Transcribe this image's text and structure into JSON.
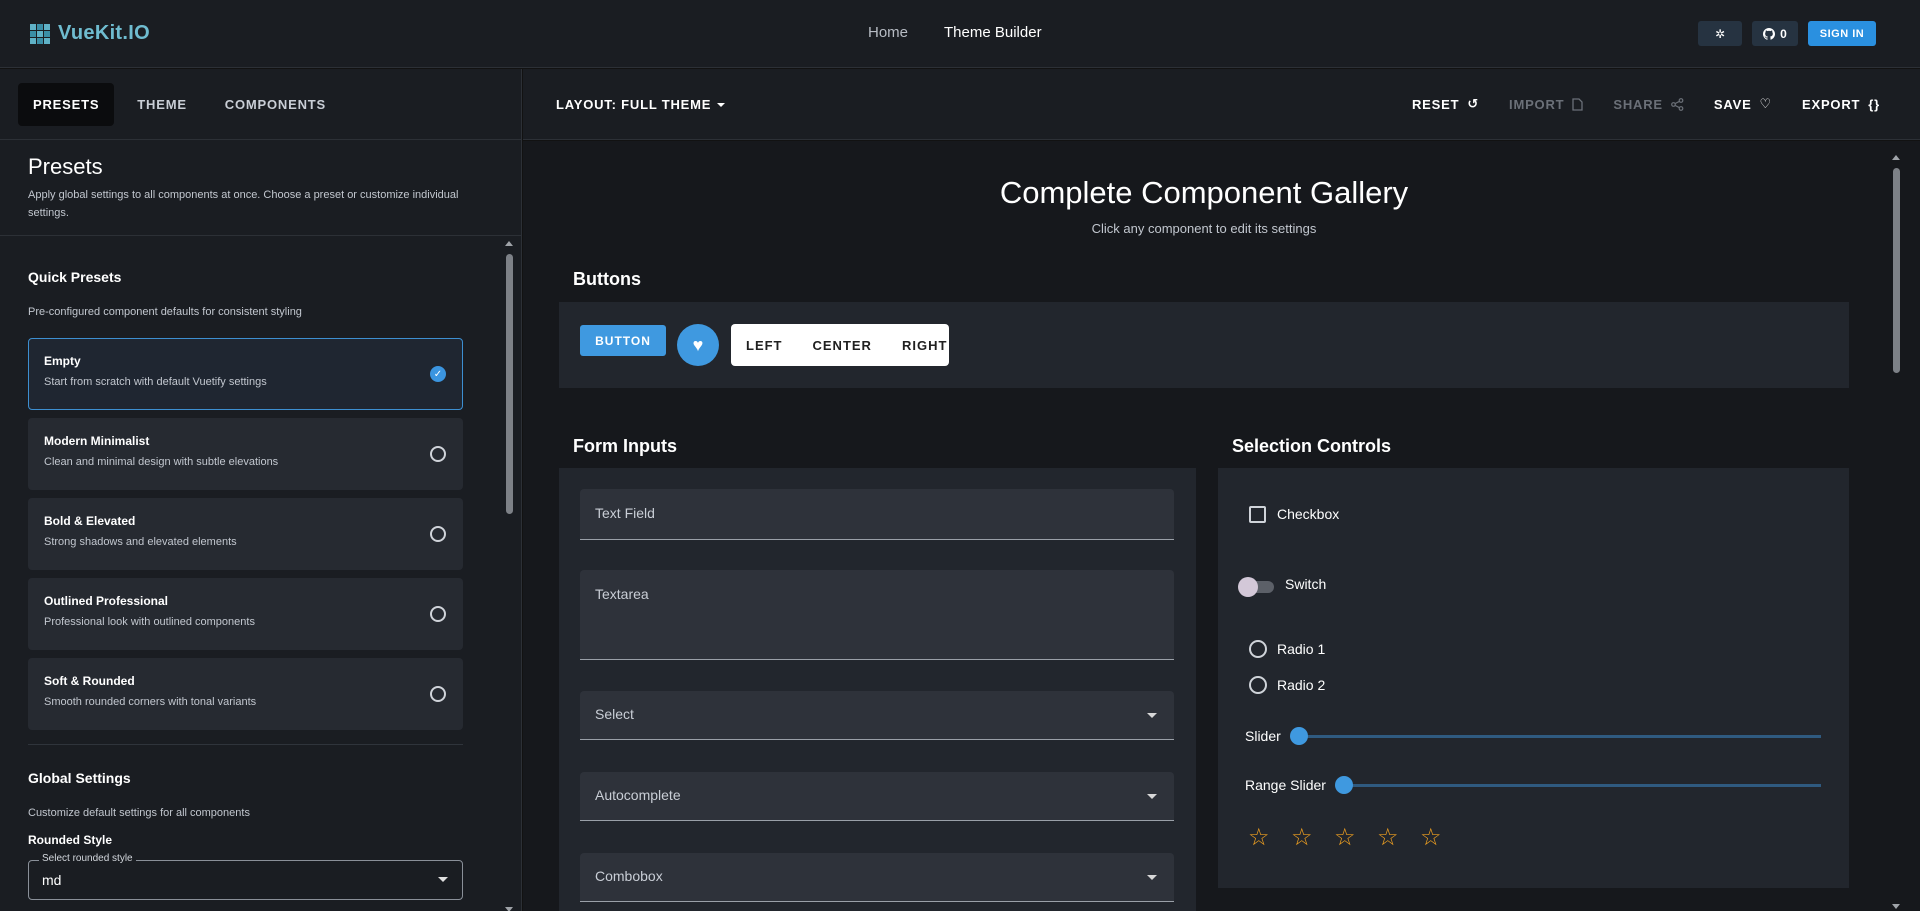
{
  "app": {
    "logo_text": "VueKit.IO",
    "nav": {
      "home": "Home",
      "theme_builder": "Theme Builder"
    },
    "theme_toggle_icon": "sun-icon",
    "github_count": "0",
    "sign_in": "SIGN IN"
  },
  "sidebar": {
    "tabs": [
      "PRESETS",
      "THEME",
      "COMPONENTS"
    ],
    "active_tab": "PRESETS",
    "title": "Presets",
    "description": "Apply global settings to all components at once. Choose a preset or customize individual settings.",
    "quick_presets": {
      "title": "Quick Presets",
      "subtitle": "Pre-configured component defaults for consistent styling",
      "items": [
        {
          "name": "Empty",
          "desc": "Start from scratch with default Vuetify settings",
          "selected": true
        },
        {
          "name": "Modern Minimalist",
          "desc": "Clean and minimal design with subtle elevations",
          "selected": false
        },
        {
          "name": "Bold & Elevated",
          "desc": "Strong shadows and elevated elements",
          "selected": false
        },
        {
          "name": "Outlined Professional",
          "desc": "Professional look with outlined components",
          "selected": false
        },
        {
          "name": "Soft & Rounded",
          "desc": "Smooth rounded corners with tonal variants",
          "selected": false
        }
      ]
    },
    "global_settings": {
      "title": "Global Settings",
      "subtitle": "Customize default settings for all components",
      "rounded_label": "Rounded Style",
      "rounded_field_label": "Select rounded style",
      "rounded_value": "md"
    }
  },
  "toolbar": {
    "layout": "LAYOUT: FULL THEME",
    "reset": "RESET",
    "import": "IMPORT",
    "share": "SHARE",
    "save": "SAVE",
    "export": "EXPORT"
  },
  "gallery": {
    "title": "Complete Component Gallery",
    "subtitle": "Click any component to edit its settings",
    "buttons": {
      "title": "Buttons",
      "primary": "BUTTON",
      "group": [
        "LEFT",
        "CENTER",
        "RIGHT"
      ]
    },
    "form_inputs": {
      "title": "Form Inputs",
      "fields": [
        "Text Field",
        "Textarea",
        "Select",
        "Autocomplete",
        "Combobox"
      ]
    },
    "selection_controls": {
      "title": "Selection Controls",
      "checkbox": "Checkbox",
      "switch": "Switch",
      "radio1": "Radio 1",
      "radio2": "Radio 2",
      "slider": "Slider",
      "range_slider": "Range Slider",
      "rating_max": 5,
      "rating_value": 0
    }
  },
  "colors": {
    "accent": "#3f99e0",
    "rating": "#f0a020",
    "logo": "#6fbcd0"
  }
}
